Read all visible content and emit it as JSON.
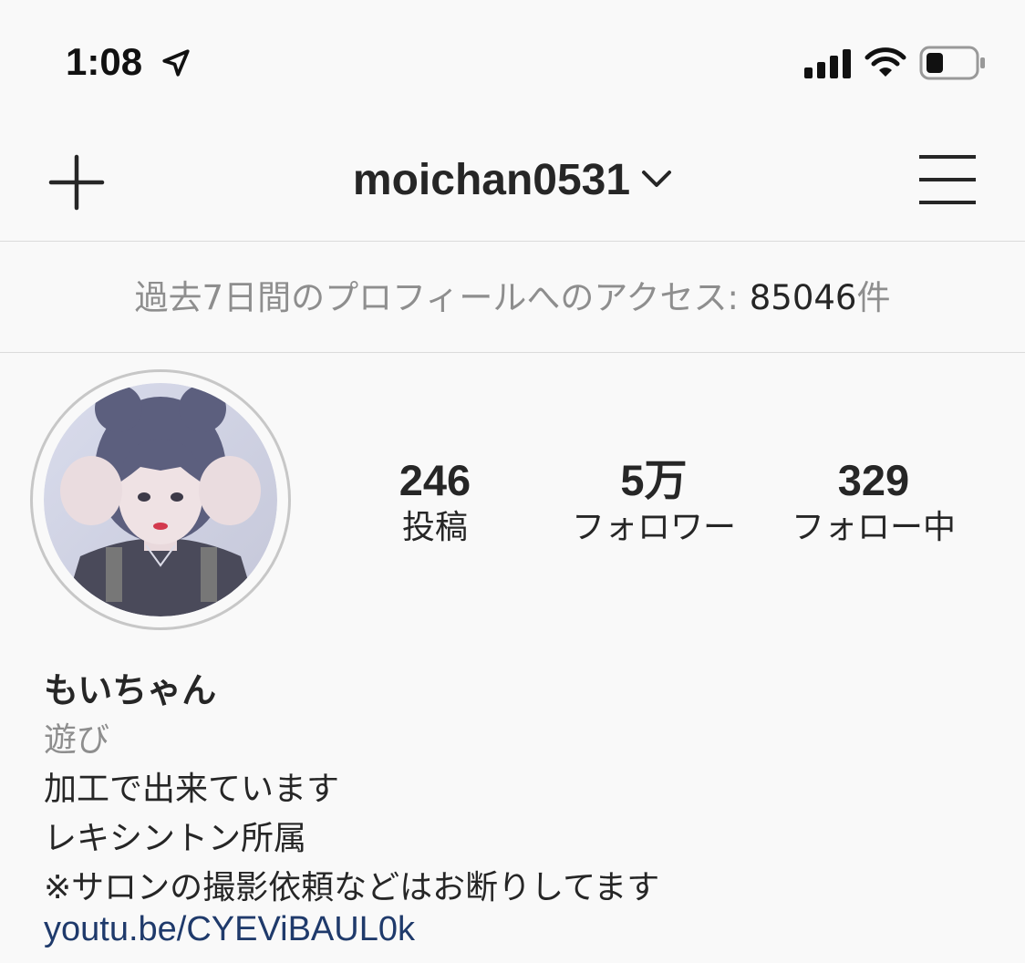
{
  "status_bar": {
    "time": "1:08",
    "icons": [
      "location-arrow-icon",
      "signal-bars-icon",
      "wifi-icon",
      "battery-icon"
    ],
    "battery_level": 0.3
  },
  "nav": {
    "username": "moichan0531",
    "left_icon": "plus-icon",
    "right_icon": "hamburger-menu-icon",
    "dropdown_icon": "chevron-down-icon"
  },
  "insights": {
    "label": "過去7日間のプロフィールへのアクセス: ",
    "count": "85046",
    "unit": "件"
  },
  "stats": [
    {
      "value": "246",
      "label": "投稿"
    },
    {
      "value": "5万",
      "label": "フォロワー"
    },
    {
      "value": "329",
      "label": "フォロー中"
    }
  ],
  "profile": {
    "display_name": "もいちゃん",
    "category": "遊び",
    "bio": [
      "加工で出来ています",
      "レキシントン所属",
      "※サロンの撮影依頼などはお断りしてます"
    ],
    "link": "youtu.be/CYEViBAUL0k"
  },
  "colors": {
    "background": "#f9f9f9",
    "text": "#262626",
    "secondary_text": "#8e8e8e",
    "link": "#1f3a6b",
    "divider": "#dbdbdb"
  }
}
